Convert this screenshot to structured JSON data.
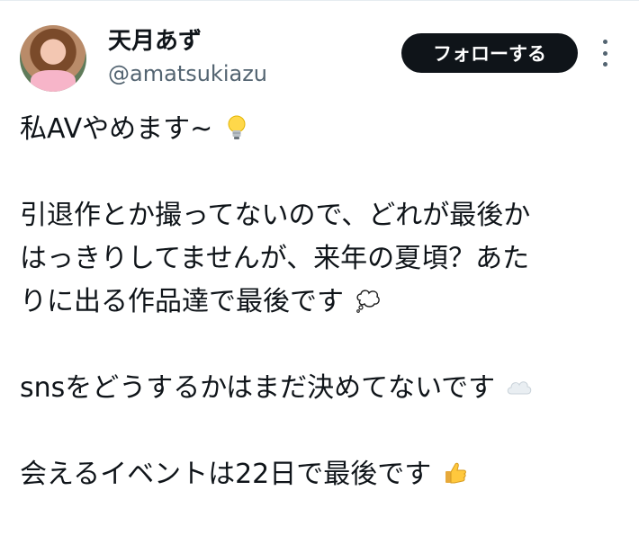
{
  "user": {
    "display_name": "天月あず",
    "handle": "@amatsukiazu"
  },
  "actions": {
    "follow_label": "フォローする"
  },
  "tweet": {
    "line1": "私AVやめます~",
    "line2": "引退作とか撮ってないので、どれが最後か",
    "line3": "はっきりしてませんが、来年の夏頃？あた",
    "line4": "りに出る作品達で最後です",
    "line5": "snsをどうするかはまだ決めてないです",
    "line6": "会えるイベントは22日で最後です",
    "emojis": [
      "light-bulb-icon",
      "thought-balloon-icon",
      "cloud-icon",
      "thumbs-up-icon"
    ]
  },
  "colors": {
    "text": "#0f1419",
    "secondary_text": "#536471",
    "button_bg": "#0f1419",
    "button_text": "#ffffff"
  }
}
